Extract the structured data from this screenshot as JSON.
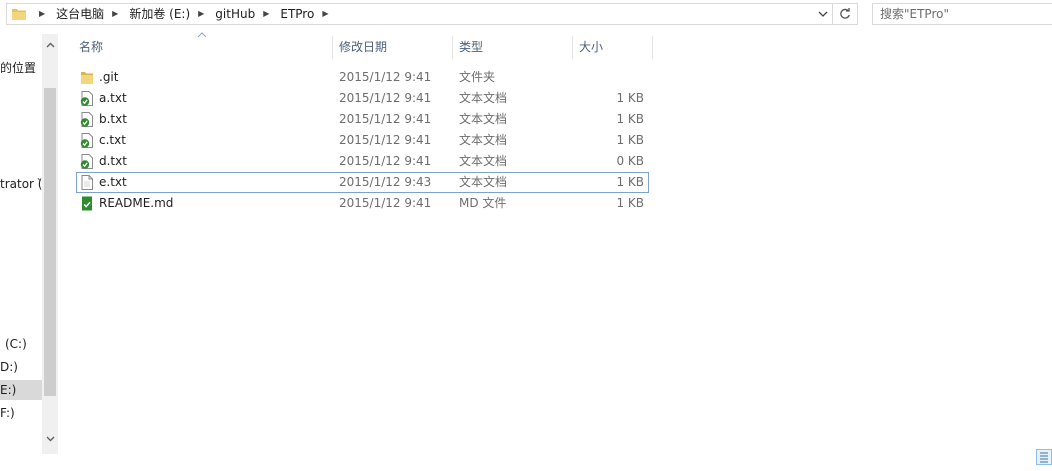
{
  "address_bar": {
    "breadcrumbs": [
      "这台电脑",
      "新加卷 (E:)",
      "gitHub",
      "ETPro"
    ]
  },
  "search": {
    "placeholder": "搜索\"ETPro\""
  },
  "nav_pane": {
    "items": [
      {
        "label": "的位置"
      },
      {
        "label": "trator (̀"
      },
      {
        "label": "(C:)"
      },
      {
        "label": "D:)"
      },
      {
        "label": "E:)"
      },
      {
        "label": "F:)"
      }
    ]
  },
  "columns": {
    "name": "名称",
    "date": "修改日期",
    "type": "类型",
    "size": "大小"
  },
  "files": [
    {
      "name": ".git",
      "date": "2015/1/12 9:41",
      "type": "文件夹",
      "size": "",
      "icon": "folder-icon"
    },
    {
      "name": "a.txt",
      "date": "2015/1/12 9:41",
      "type": "文本文档",
      "size": "1 KB",
      "icon": "git-synced-text-file-icon"
    },
    {
      "name": "b.txt",
      "date": "2015/1/12 9:41",
      "type": "文本文档",
      "size": "1 KB",
      "icon": "git-synced-text-file-icon"
    },
    {
      "name": "c.txt",
      "date": "2015/1/12 9:41",
      "type": "文本文档",
      "size": "1 KB",
      "icon": "git-synced-text-file-icon"
    },
    {
      "name": "d.txt",
      "date": "2015/1/12 9:41",
      "type": "文本文档",
      "size": "0 KB",
      "icon": "git-synced-text-file-icon"
    },
    {
      "name": "e.txt",
      "date": "2015/1/12 9:43",
      "type": "文本文档",
      "size": "1 KB",
      "icon": "text-file-icon"
    },
    {
      "name": "README.md",
      "date": "2015/1/12 9:41",
      "type": "MD 文件",
      "size": "1 KB",
      "icon": "git-synced-md-file-icon"
    }
  ],
  "colors": {
    "header_text": "#4c607a",
    "focus_border": "#7da2ce",
    "git_badge": "#2e8b2e",
    "folder": "#e8c15a"
  }
}
